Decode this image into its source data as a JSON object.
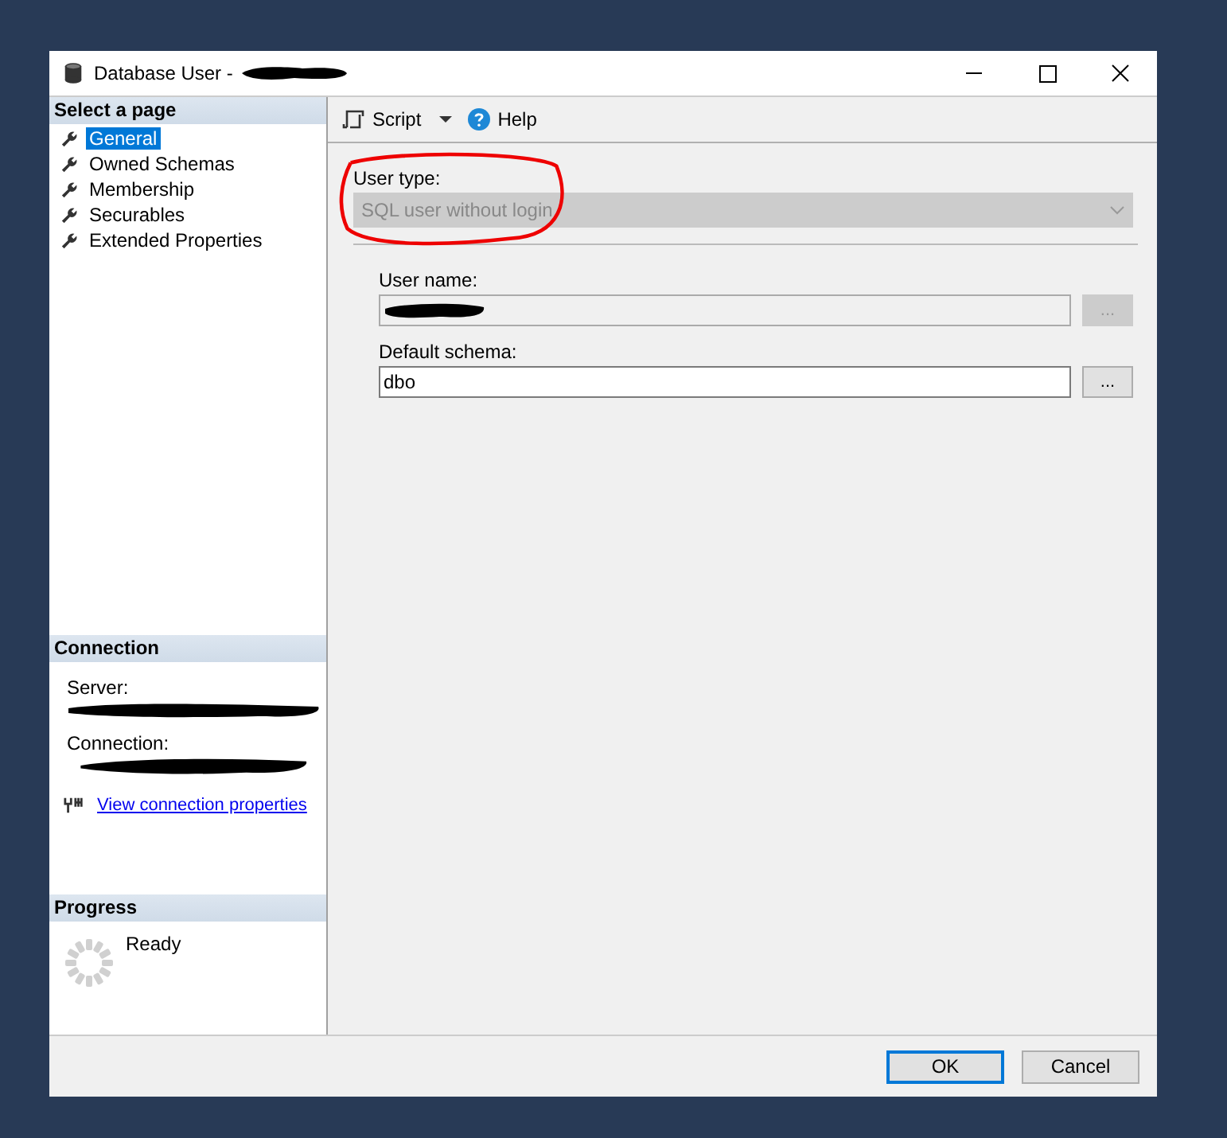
{
  "window": {
    "title": "Database User -"
  },
  "sidebar": {
    "title": "Select a page",
    "items": [
      {
        "label": "General",
        "selected": true
      },
      {
        "label": "Owned Schemas",
        "selected": false
      },
      {
        "label": "Membership",
        "selected": false
      },
      {
        "label": "Securables",
        "selected": false
      },
      {
        "label": "Extended Properties",
        "selected": false
      }
    ]
  },
  "connection": {
    "title": "Connection",
    "server_label": "Server:",
    "connection_label": "Connection:",
    "link": "View connection properties"
  },
  "progress": {
    "title": "Progress",
    "status": "Ready"
  },
  "toolbar": {
    "script": "Script",
    "help": "Help"
  },
  "form": {
    "user_type": {
      "label": "User type:",
      "value": "SQL user without login",
      "disabled": true
    },
    "user_name": {
      "label": "User name:",
      "disabled": true,
      "browse": "..."
    },
    "default_schema": {
      "label": "Default schema:",
      "value": "dbo",
      "disabled": false,
      "browse": "..."
    }
  },
  "buttons": [
    {
      "label": "OK",
      "default": true
    },
    {
      "label": "Cancel",
      "default": false
    }
  ]
}
